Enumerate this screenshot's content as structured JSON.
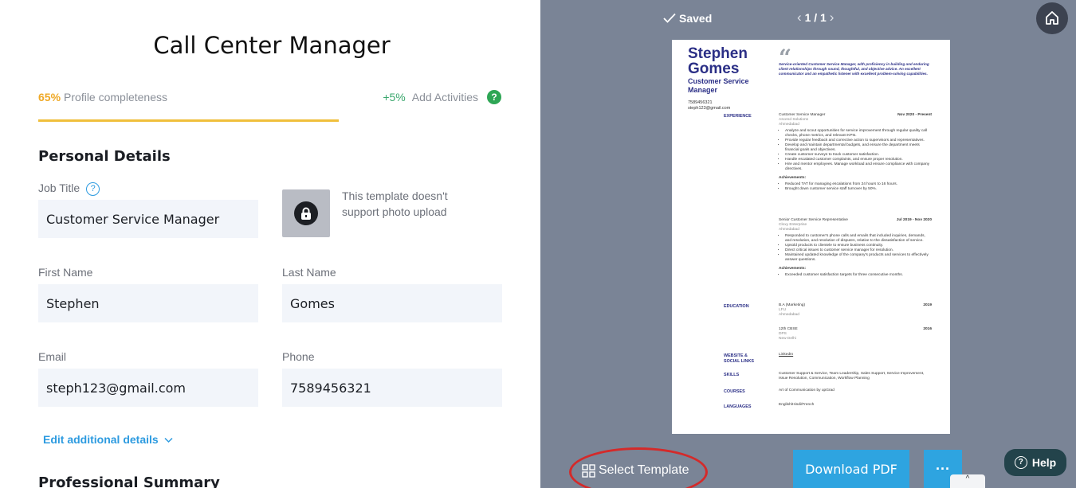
{
  "editor": {
    "doc_title": "Call Center Manager",
    "completeness_pct": "65%",
    "completeness_label": "Profile completeness",
    "progress_value": 0.65,
    "boost_value": "+5%",
    "boost_label": "Add Activities",
    "help_glyph": "?",
    "personal_details_title": "Personal Details",
    "job_title_label": "Job Title",
    "job_title_value": "Customer Service Manager",
    "photo_note": "This template doesn't support photo upload",
    "first_name_label": "First Name",
    "first_name_value": "Stephen",
    "last_name_label": "Last Name",
    "last_name_value": "Gomes",
    "email_label": "Email",
    "email_value": "steph123@gmail.com",
    "phone_label": "Phone",
    "phone_value": "7589456321",
    "edit_additional": "Edit additional details",
    "professional_summary_title": "Professional Summary"
  },
  "preview": {
    "saved_label": "Saved",
    "page_indicator": "1 / 1",
    "select_template": "Select Template",
    "download_pdf": "Download PDF",
    "more": "···",
    "help": "Help",
    "up_arrow": "^",
    "icons": [
      "check-icon",
      "chevron-left-icon",
      "chevron-right-icon",
      "home-icon",
      "grid-icon",
      "lock-icon",
      "question-icon"
    ]
  },
  "resume": {
    "first_name": "Stephen",
    "last_name": "Gomes",
    "role": "Customer Service Manager",
    "phone": "7589456321",
    "email": "steph123@gmail.com",
    "summary": "Service-oriented Customer Service Manager, with proficiency in building and enduring client relationships through sound, thoughtful, and objective advice. An excellent communicator and an empathetic listener with excellent problem-solving capabilities.",
    "experience_label": "EXPERIENCE",
    "job1": {
      "title": "Customer Service Manager",
      "date": "Nov 2020 - Present",
      "company": "Ascend Solutions",
      "city": "Ahmedabad",
      "bullets": [
        "Analyze and scout opportunities for service improvement through regular quality call checks, phone metrics, and relevant KPIs.",
        "Provide regular feedback and corrective action to supervisors and representatives.",
        "Develop and maintain departmental budgets, and ensure the department meets financial goals and objectives.",
        "Create customer surveys to track customer satisfaction.",
        "Handle escalated customer complaints, and ensure proper resolution.",
        "Hire and mentor employees. Manage workload and ensure compliance with company directives."
      ],
      "ach_label": "Achievements:",
      "achievements": [
        "Reduced TAT for managing escalations from 24 hours to 16 hours.",
        "Brought down customer service staff turnover by 50%."
      ]
    },
    "job2": {
      "title": "Senior Customer Service Representative",
      "date": "Jul 2019 - Nov 2020",
      "company": "Cloxy Enterprise",
      "city": "Ahmedabad",
      "bullets": [
        "Responded to customer's phone calls and emails that included inquiries, demands, and resolution, and resolution of disputes, relative to the dissatisfaction of service.",
        "Upsold products to clientele to ensure business continuity.",
        "Direct critical issues to customer service manager for resolution.",
        "Maintained updated knowledge of the company's products and services to effectively answer questions."
      ],
      "ach_label": "Achievements:",
      "achievements": [
        "Exceeded customer satisfaction targets for three consecutive months."
      ]
    },
    "education_label": "EDUCATION",
    "edu1": {
      "degree": "B.A (Marketing)",
      "year": "2019",
      "school": "LFU",
      "city": "Ahmedabad"
    },
    "edu2": {
      "degree": "12th CBSE",
      "year": "2016",
      "school": "DPS",
      "city": "New Delhi"
    },
    "website_label": "WEBSITE & SOCIAL LINKS",
    "website_value": "LinkedIn",
    "skills_label": "SKILLS",
    "skills_value": "Customer Support & Service, Team Leadership, Sales Support, Service Improvement, Issue Resolution, Communication, Workflow Planning",
    "courses_label": "COURSES",
    "courses_value": "Art of Communication by upGrad",
    "languages_label": "LANGUAGES",
    "languages_value": "English/Hindi/French",
    "quote_glyph": "“"
  }
}
